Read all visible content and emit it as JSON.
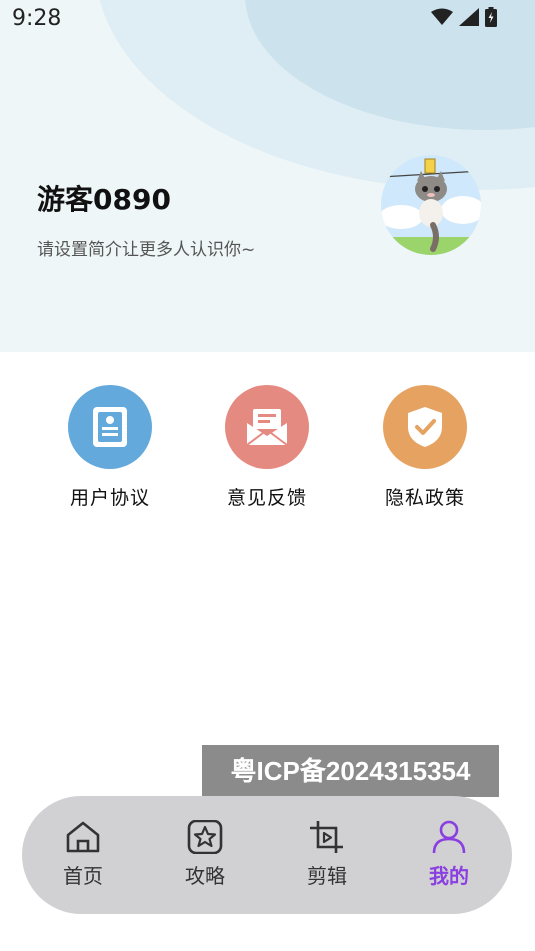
{
  "status_bar": {
    "time": "9:28",
    "icons": [
      "wifi-icon",
      "signal-icon",
      "battery-icon"
    ]
  },
  "profile": {
    "username": "游客0890",
    "bio": "请设置简介让更多人认识你~"
  },
  "actions": [
    {
      "label": "用户协议",
      "icon": "document-icon",
      "color": "#64a9dc"
    },
    {
      "label": "意见反馈",
      "icon": "mail-icon",
      "color": "#e58a80"
    },
    {
      "label": "隐私政策",
      "icon": "shield-check-icon",
      "color": "#e6a260"
    }
  ],
  "icp": "粤ICP备2024315354",
  "tabbar": {
    "items": [
      {
        "label": "首页",
        "icon": "home-icon",
        "active": false
      },
      {
        "label": "攻略",
        "icon": "star-icon",
        "active": false
      },
      {
        "label": "剪辑",
        "icon": "crop-icon",
        "active": false
      },
      {
        "label": "我的",
        "icon": "user-icon",
        "active": true
      }
    ],
    "active_color": "#8a3fe0"
  }
}
